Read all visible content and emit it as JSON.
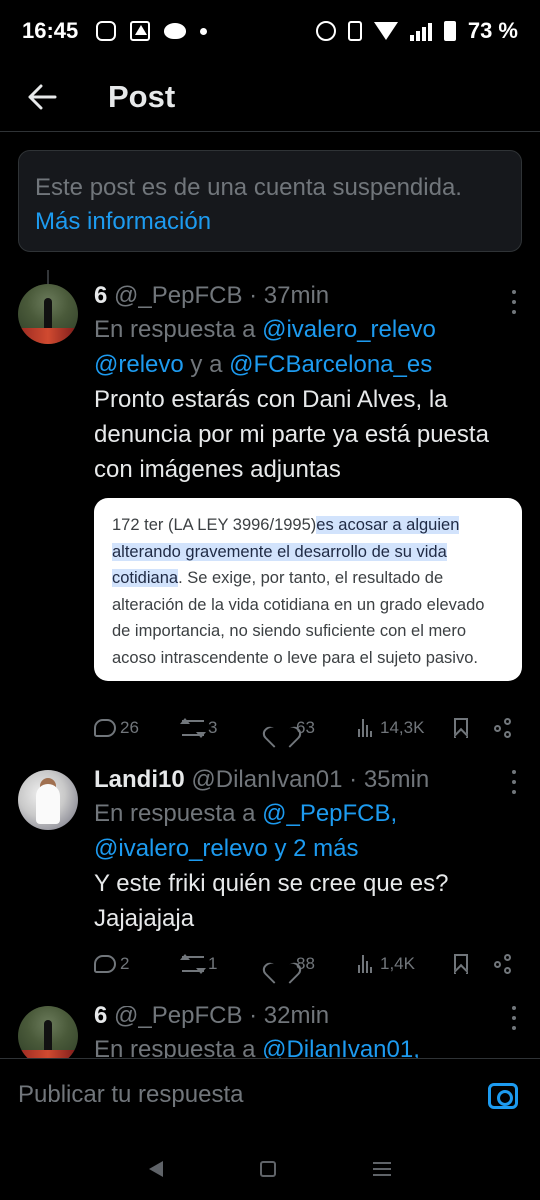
{
  "status_bar": {
    "time": "16:45",
    "battery": "73 %"
  },
  "header": {
    "title": "Post"
  },
  "notice": {
    "text": "Este post es de una cuenta suspendida.",
    "link": "Más información"
  },
  "tweets": [
    {
      "name": "6",
      "handle": "@_PepFCB",
      "time": "· 37min",
      "reply_prefix": "En respuesta a",
      "reply_mentions_1": "@ivalero_relevo",
      "reply_mentions_2": "@relevo",
      "reply_joiner": "y a",
      "reply_mentions_3": "@FCBarcelona_es",
      "text": "Pronto estarás con Dani Alves, la denuncia por mi parte ya está puesta con imágenes adjuntas",
      "image_text_plain_1": "172 ter (LA LEY 3996/1995)",
      "image_text_highlight": "es acosar a alguien alterando gravemente el desarrollo de su vida cotidiana",
      "image_text_plain_2": ". Se exige, por tanto, el resultado de alteración de la vida cotidiana en un grado elevado de importancia, no siendo suficiente con el mero acoso intrascendente o leve para el sujeto pasivo.",
      "replies": "26",
      "retweets": "3",
      "likes": "63",
      "views": "14,3K"
    },
    {
      "name": "Landi10",
      "handle": "@DilanIvan01",
      "time": "· 35min",
      "reply_prefix": "En respuesta a",
      "reply_mentions_1": "@_PepFCB,",
      "reply_mentions_2": "@ivalero_relevo",
      "reply_joiner": "y",
      "reply_mentions_3": "2 más",
      "text": "Y este friki quién se cree que es? Jajajajaja",
      "replies": "2",
      "retweets": "1",
      "likes": "88",
      "views": "1,4K"
    },
    {
      "name": "6",
      "handle": "@_PepFCB",
      "time": "· 32min",
      "reply_prefix": "En respuesta a",
      "reply_mentions_1": "@DilanIvan01,"
    }
  ],
  "compose": {
    "placeholder": "Publicar tu respuesta"
  },
  "colors": {
    "accent": "#1d9bf0",
    "background": "#000000",
    "muted": "#71767b"
  }
}
